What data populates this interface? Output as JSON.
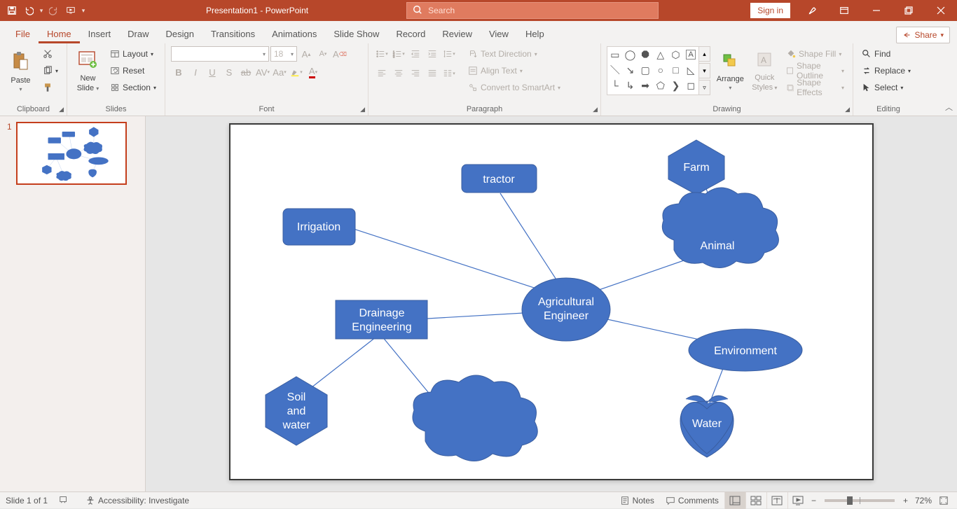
{
  "app": {
    "title": "Presentation1 - PowerPoint"
  },
  "search": {
    "placeholder": "Search"
  },
  "signin": {
    "label": "Sign in"
  },
  "tabs": {
    "file": "File",
    "home": "Home",
    "insert": "Insert",
    "draw": "Draw",
    "design": "Design",
    "transitions": "Transitions",
    "animations": "Animations",
    "slideshow": "Slide Show",
    "record": "Record",
    "review": "Review",
    "view": "View",
    "help": "Help"
  },
  "share": {
    "label": "Share"
  },
  "ribbon": {
    "clipboard": {
      "label": "Clipboard",
      "paste": "Paste"
    },
    "slides": {
      "label": "Slides",
      "new1": "New",
      "new2": "Slide",
      "layout": "Layout",
      "reset": "Reset",
      "section": "Section"
    },
    "font": {
      "label": "Font",
      "size": "18"
    },
    "paragraph": {
      "label": "Paragraph",
      "textdir": "Text Direction",
      "align": "Align Text",
      "smart": "Convert to SmartArt"
    },
    "drawing": {
      "label": "Drawing",
      "arrange": "Arrange",
      "quick1": "Quick",
      "quick2": "Styles",
      "fill": "Shape Fill",
      "outline": "Shape Outline",
      "effects": "Shape Effects"
    },
    "editing": {
      "label": "Editing",
      "find": "Find",
      "replace": "Replace",
      "select": "Select"
    }
  },
  "thumbs": {
    "n1": "1"
  },
  "slide": {
    "tractor": "tractor",
    "irrigation": "Irrigation",
    "farm": "Farm",
    "animal": "Animal",
    "center1": "Agricultural",
    "center2": "Engineer",
    "drain1": "Drainage",
    "drain2": "Engineering",
    "soil1": "Soil",
    "soil2": "and",
    "soil3": "water",
    "env": "Environment",
    "water": "Water"
  },
  "status": {
    "slide": "Slide 1 of 1",
    "access": "Accessibility: Investigate",
    "notes": "Notes",
    "comments": "Comments",
    "zoom": "72%"
  },
  "colors": {
    "shape": "#4472c4",
    "shapeBorder": "#3a5ea0",
    "line": "#4472c4"
  }
}
